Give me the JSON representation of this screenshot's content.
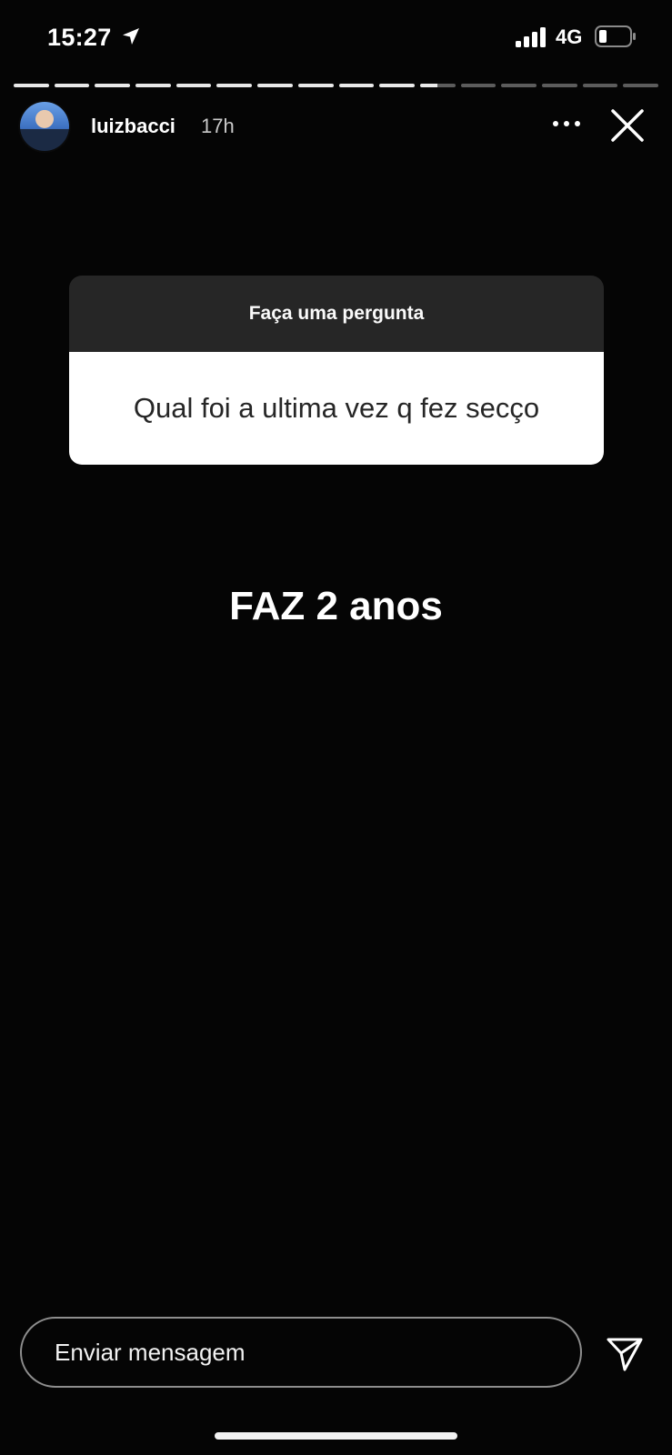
{
  "status_bar": {
    "time": "15:27",
    "location_icon": "location-arrow-icon",
    "signal_icon": "cellular-signal-icon",
    "network": "4G",
    "battery_icon": "battery-icon"
  },
  "story": {
    "segments_total": 16,
    "segments_viewed": 10,
    "current_segment_progress": 0.5,
    "username": "luizbacci",
    "time_ago": "17h",
    "more_icon": "more-horizontal-icon",
    "close_icon": "close-icon"
  },
  "question_sticker": {
    "header": "Faça uma pergunta",
    "question": "Qual foi a ultima vez q fez secço"
  },
  "answer_text": "FAZ 2 anos",
  "reply_bar": {
    "placeholder": "Enviar mensagem",
    "send_icon": "send-paper-plane-icon"
  },
  "colors": {
    "background": "#050505",
    "sticker_header": "#262626",
    "sticker_body": "#ffffff",
    "text": "#ffffff"
  }
}
